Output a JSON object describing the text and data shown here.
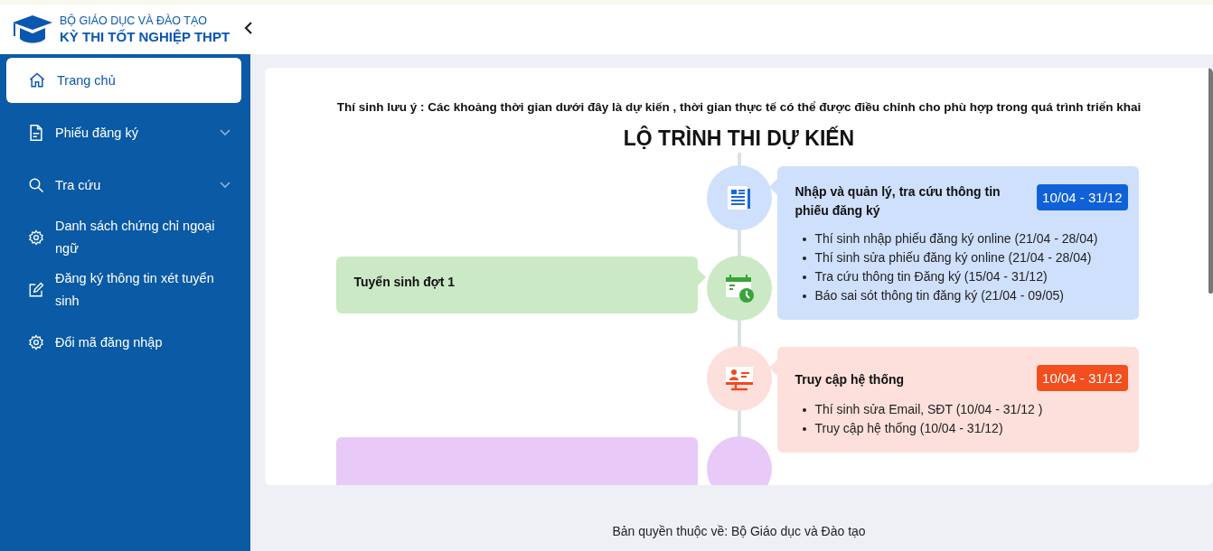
{
  "header": {
    "org": "BỘ GIÁO DỤC VÀ ĐÀO TẠO",
    "title": "KỲ THI TỐT NGHIỆP THPT"
  },
  "sidebar": {
    "items": [
      {
        "label": "Trang chủ",
        "kind": "home",
        "selected": true,
        "expandable": false
      },
      {
        "label": "Phiếu đăng ký",
        "kind": "document",
        "selected": false,
        "expandable": true
      },
      {
        "label": "Tra cứu",
        "kind": "search",
        "selected": false,
        "expandable": true
      },
      {
        "label": "Danh sách chứng chỉ ngoại ngữ",
        "kind": "gear",
        "selected": false,
        "expandable": false
      },
      {
        "label": "Đăng ký thông tin xét tuyển sinh",
        "kind": "edit",
        "selected": false,
        "expandable": false
      },
      {
        "label": "Đổi mã đăng nhập",
        "kind": "gear",
        "selected": false,
        "expandable": false
      }
    ]
  },
  "notice": "Thí sinh lưu ý : Các khoảng thời gian dưới đây là dự kiến , thời gian thực tế có thể được điều chỉnh cho phù hợp trong quá trình triển khai",
  "heading": "LỘ TRÌNH THI DỰ KIẾN",
  "timeline": [
    {
      "kind": "document",
      "color": "#cfe0fc",
      "title": "Nhập và quản lý, tra cứu thông tin phiếu đăng ký",
      "badge": "10/04 - 31/12",
      "bullets": [
        "Thí sinh nhập phiếu đăng ký online (21/04 - 28/04)",
        "Thí sinh sửa phiếu đăng ký online (21/04 - 28/04)",
        "Tra cứu thông tin Đăng ký (15/04 - 31/12)",
        "Báo sai sót thông tin đăng ký (21/04 - 09/05)"
      ]
    },
    {
      "kind": "calendar",
      "color": "#cbe9c4",
      "title": "Tuyển sinh đợt 1"
    },
    {
      "kind": "monitor",
      "color": "#fde0db",
      "title": "Truy cập hệ thống",
      "badge": "10/04 - 31/12",
      "bullets": [
        "Thí sinh sửa Email, SĐT (10/04 - 31/12 )",
        "Truy cập hệ thống (10/04 - 31/12)"
      ]
    },
    {
      "kind": "hidden",
      "color": "#e8c9f7"
    }
  ],
  "footer": "Bản quyền thuộc về: Bộ Giáo dục và Đào tạo"
}
